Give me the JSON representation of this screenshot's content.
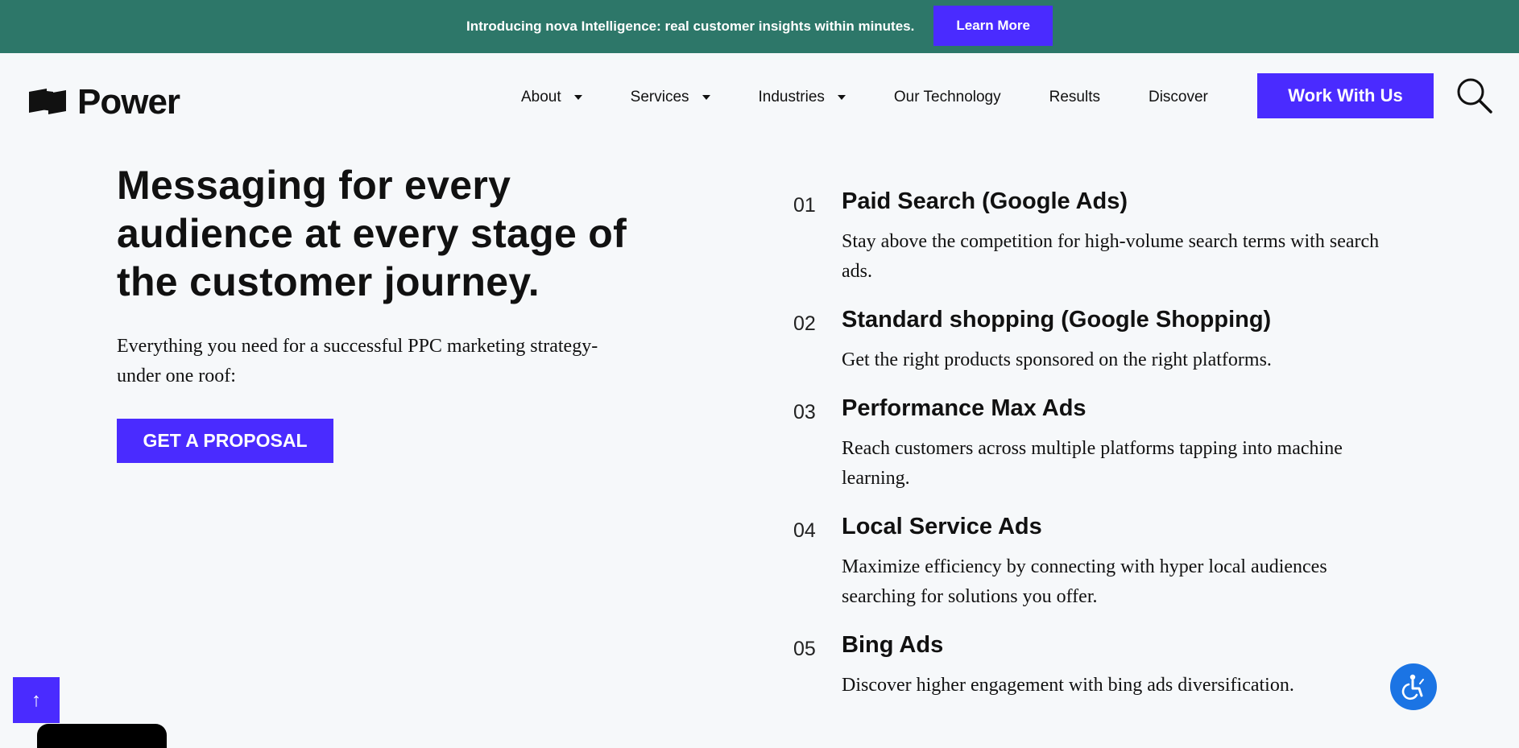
{
  "announcement": {
    "text": "Introducing nova Intelligence: real customer insights within minutes.",
    "button": "Learn More"
  },
  "logo": {
    "text": "Power"
  },
  "nav": {
    "items": [
      {
        "label": "About",
        "dropdown": true
      },
      {
        "label": "Services",
        "dropdown": true
      },
      {
        "label": "Industries",
        "dropdown": true
      },
      {
        "label": "Our Technology",
        "dropdown": false
      },
      {
        "label": "Results",
        "dropdown": false
      },
      {
        "label": "Discover",
        "dropdown": false
      }
    ],
    "cta": "Work With Us",
    "search_icon": "search-icon"
  },
  "hero": {
    "title": "Messaging for every audience at every stage of the customer journey.",
    "subtitle": "Everything you need for a successful PPC marketing strategy-under one roof:",
    "button": "GET A PROPOSAL"
  },
  "services": [
    {
      "num": "01",
      "title": "Paid Search (Google Ads)",
      "desc": "Stay above the competition for high-volume search terms with search ads."
    },
    {
      "num": "02",
      "title": "Standard shopping (Google Shopping)",
      "desc": "Get the right products sponsored on the right platforms."
    },
    {
      "num": "03",
      "title": "Performance Max Ads",
      "desc": "Reach customers across multiple platforms tapping into machine learning."
    },
    {
      "num": "04",
      "title": "Local Service Ads",
      "desc": "Maximize efficiency by connecting with hyper local audiences searching for solutions you offer."
    },
    {
      "num": "05",
      "title": "Bing Ads",
      "desc": "Discover higher engagement with bing ads diversification."
    }
  ],
  "widgets": {
    "scroll_top_glyph": "↑",
    "accessibility_icon": "accessibility-icon"
  },
  "colors": {
    "announce_bg": "#2d7769",
    "accent": "#4a2bff",
    "page_bg": "#f6f8fa",
    "access_blue": "#1b74e4"
  }
}
